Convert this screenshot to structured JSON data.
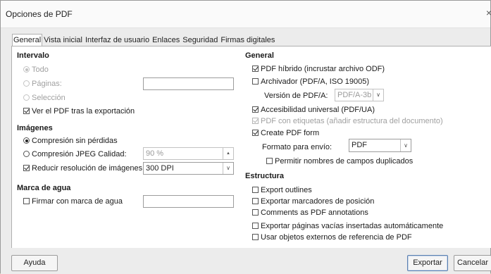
{
  "window": {
    "title": "Opciones de PDF",
    "close_glyph": "×"
  },
  "tabs": [
    "General",
    "Vista inicial",
    "Interfaz de usuario",
    "Enlaces",
    "Seguridad",
    "Firmas digitales"
  ],
  "left": {
    "range": {
      "heading": "Intervalo",
      "all": "Todo",
      "pages": "Páginas:",
      "pages_value": "",
      "selection": "Selección",
      "view_after": "Ver el PDF tras la exportación"
    },
    "images": {
      "heading": "Imágenes",
      "lossless": "Compresión sin pérdidas",
      "jpeg": "Compresión JPEG Calidad:",
      "jpeg_quality": "90 %",
      "reduce": "Reducir resolución de imágenes",
      "dpi": "300 DPI"
    },
    "watermark": {
      "heading": "Marca de agua",
      "sign": "Firmar con marca de agua",
      "sign_value": ""
    }
  },
  "right": {
    "general": {
      "heading": "General",
      "hybrid": "PDF híbrido (incrustar archivo ODF)",
      "archive": "Archivador (PDF/A, ISO 19005)",
      "pdfa_version_label": "Versión de PDF/A:",
      "pdfa_version": "PDF/A-3b",
      "accessibility": "Accesibilidad universal (PDF/UA)",
      "tagged": "PDF con etiquetas (añadir estructura del documento)",
      "create_form": "Create PDF form",
      "submit_format_label": "Formato para envío:",
      "submit_format": "PDF",
      "allow_duplicates": "Permitir nombres de campos duplicados"
    },
    "structure": {
      "heading": "Estructura",
      "export_outlines": "Export outlines",
      "export_bookmarks": "Exportar marcadores de posición",
      "comments": "Comments as PDF annotations",
      "empty_pages": "Exportar páginas vacías insertadas automáticamente",
      "external_objects": "Usar objetos externos de referencia de PDF"
    }
  },
  "footer": {
    "help": "Ayuda",
    "export": "Exportar",
    "cancel": "Cancelar"
  }
}
